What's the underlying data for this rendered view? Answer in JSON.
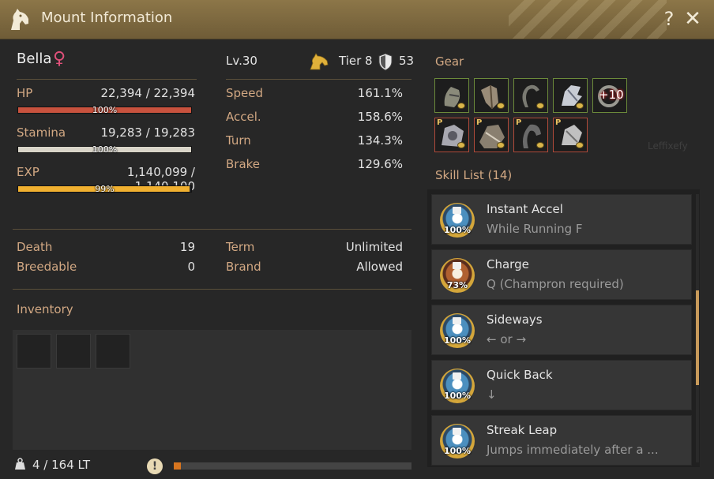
{
  "window": {
    "title": "Mount Information"
  },
  "mount": {
    "name": "Bella",
    "gender_symbol": "♀",
    "level": "Lv.30",
    "tier": "Tier 8",
    "armor": "53"
  },
  "bars": [
    {
      "label": "HP",
      "value": "22,394 / 22,394",
      "pct_text": "100%",
      "fill": 1.0,
      "color": "#c8523e"
    },
    {
      "label": "Stamina",
      "value": "19,283 / 19,283",
      "pct_text": "100%",
      "fill": 1.0,
      "color": "#d8d4c8"
    },
    {
      "label": "EXP",
      "value": "1,140,099 / 1,140,100",
      "pct_text": "99%",
      "fill": 0.99,
      "color": "#f0b030"
    }
  ],
  "movement": [
    {
      "label": "Speed",
      "value": "161.1%"
    },
    {
      "label": "Accel.",
      "value": "158.6%"
    },
    {
      "label": "Turn",
      "value": "134.3%"
    },
    {
      "label": "Brake",
      "value": "129.6%"
    }
  ],
  "info": [
    {
      "label": "Death",
      "value": "19"
    },
    {
      "label": "Breedable",
      "value": "0"
    },
    {
      "label": "Term",
      "value": "Unlimited"
    },
    {
      "label": "Brand",
      "value": "Allowed"
    }
  ],
  "inventory": {
    "title": "Inventory",
    "weight": "4 / 164 LT",
    "weight_fill": 0.03,
    "warn_symbol": "!"
  },
  "gear": {
    "title": "Gear",
    "enhance_label": "+10",
    "premium_label": "P",
    "watermark": "Leffixefy"
  },
  "skills": {
    "title": "Skill List (14)",
    "items": [
      {
        "name": "Instant Accel",
        "key": "While Running F",
        "pct": "100%",
        "icon": "skill-blue"
      },
      {
        "name": "Charge",
        "key": "Q (Champron required)",
        "pct": "73%",
        "icon": "skill-red"
      },
      {
        "name": "Sideways",
        "key": "← or →",
        "pct": "100%",
        "icon": "skill-blue"
      },
      {
        "name": "Quick Back",
        "key": "↓",
        "pct": "100%",
        "icon": "skill-blue"
      },
      {
        "name": "Streak Leap",
        "key": "Jumps immediately after a ...",
        "pct": "100%",
        "icon": "skill-blue"
      }
    ]
  },
  "icons": {
    "title": "horse-head-icon",
    "help": "question-mark-icon",
    "close": "close-icon",
    "weight": "weight-icon",
    "warning": "warning-icon"
  },
  "colors": {
    "title_bar": "#7d6a42",
    "label": "#d2a883",
    "accent": "#c89a5a"
  }
}
